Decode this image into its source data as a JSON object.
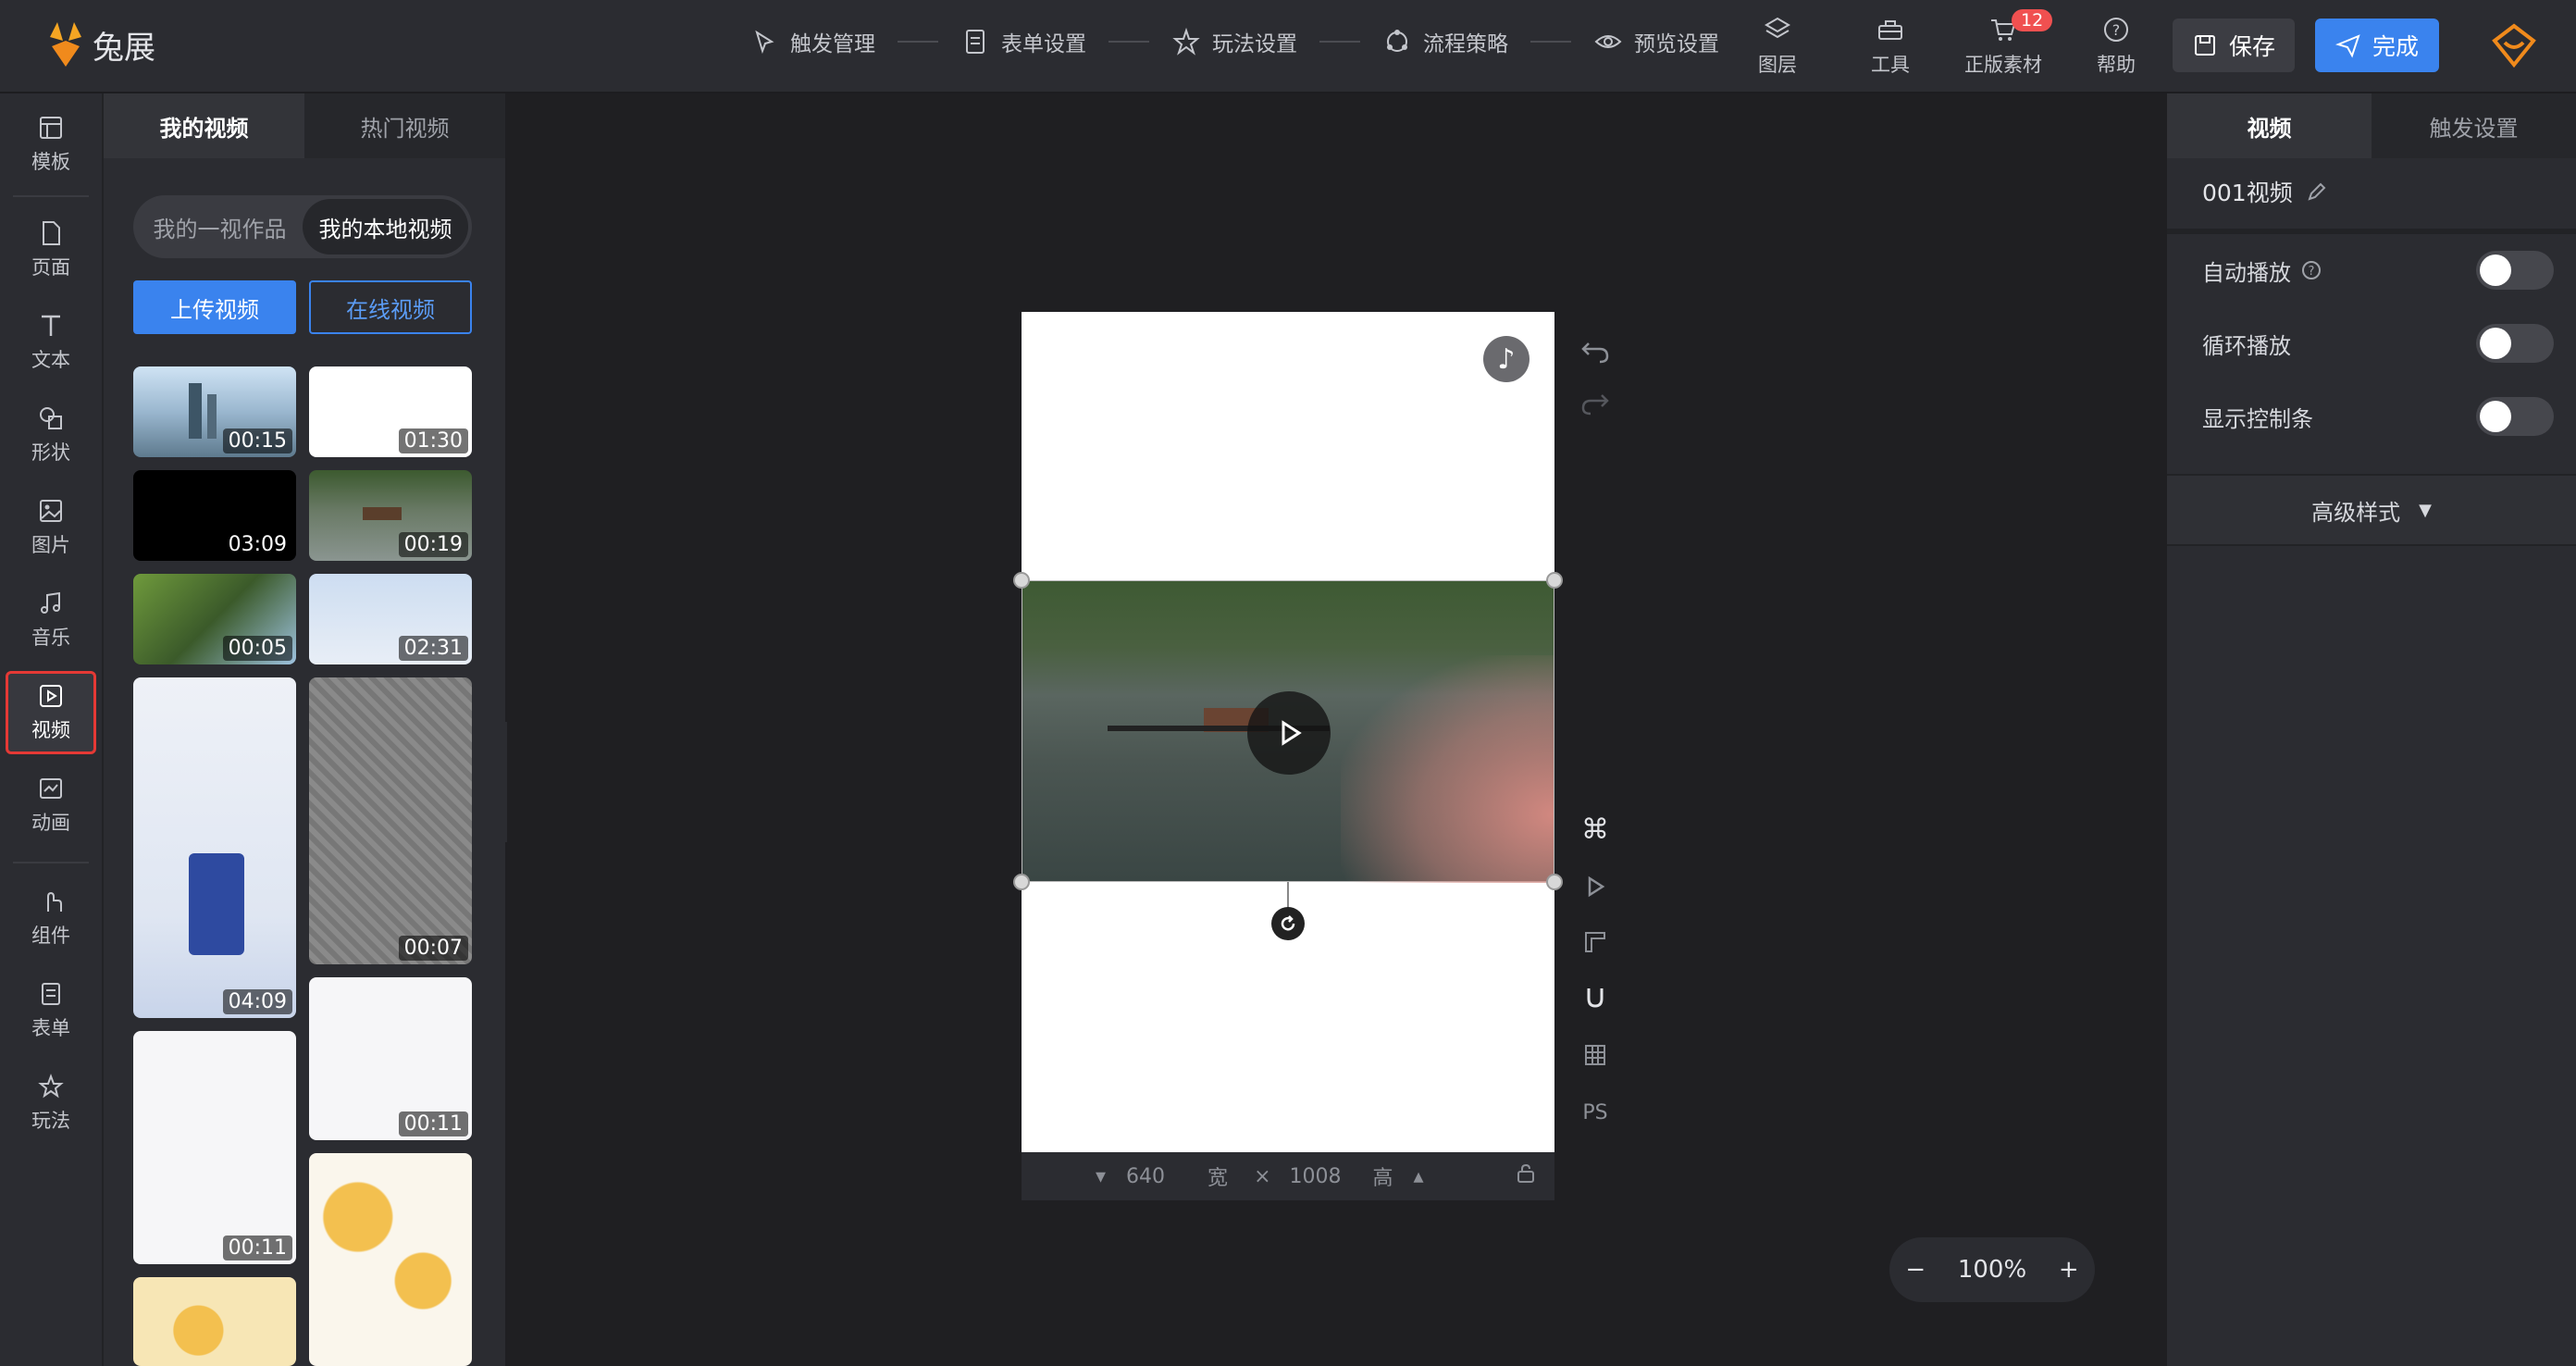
{
  "app": {
    "name": "兔展"
  },
  "steps": [
    {
      "label": "触发管理",
      "icon": "cursor-click-icon"
    },
    {
      "label": "表单设置",
      "icon": "form-icon"
    },
    {
      "label": "玩法设置",
      "icon": "star-icon"
    },
    {
      "label": "流程策略",
      "icon": "flow-icon"
    },
    {
      "label": "预览设置",
      "icon": "eye-icon"
    }
  ],
  "toolbar": {
    "layers": "图层",
    "tools": "工具",
    "assets": "正版素材",
    "assets_badge": "12",
    "help": "帮助",
    "save": "保存",
    "done": "完成"
  },
  "iconbar": [
    {
      "label": "模板",
      "icon": "template-icon"
    },
    {
      "label": "页面",
      "icon": "page-icon"
    },
    {
      "label": "文本",
      "icon": "text-icon"
    },
    {
      "label": "形状",
      "icon": "shape-icon"
    },
    {
      "label": "图片",
      "icon": "image-icon"
    },
    {
      "label": "音乐",
      "icon": "music-icon"
    },
    {
      "label": "视频",
      "icon": "video-icon",
      "active": true
    },
    {
      "label": "动画",
      "icon": "animation-icon"
    },
    {
      "label": "组件",
      "icon": "component-icon"
    },
    {
      "label": "表单",
      "icon": "form-icon"
    },
    {
      "label": "玩法",
      "icon": "play-icon"
    }
  ],
  "panel": {
    "tabs": [
      "我的视频",
      "热门视频"
    ],
    "segments": [
      "我的一视作品",
      "我的本地视频"
    ],
    "upload": "上传视频",
    "online": "在线视频",
    "thumbs": [
      "00:15",
      "01:30",
      "03:09",
      "00:19",
      "00:05",
      "02:31",
      "04:09",
      "00:07",
      "00:11",
      "00:11"
    ]
  },
  "canvas": {
    "width_value": "640",
    "width_label": "宽",
    "height_value": "1008",
    "height_label": "高",
    "tool_ps": "PS",
    "zoom": "100%",
    "zoom_minus": "−",
    "zoom_plus": "+"
  },
  "rpanel": {
    "tabs": [
      "视频",
      "触发设置"
    ],
    "name": "001视频",
    "autoplay": "自动播放",
    "loop": "循环播放",
    "controls": "显示控制条",
    "advanced": "高级样式"
  },
  "colors": {
    "accent": "#3a83ee",
    "brand": "#f5a623",
    "active_outline": "#e53935"
  }
}
